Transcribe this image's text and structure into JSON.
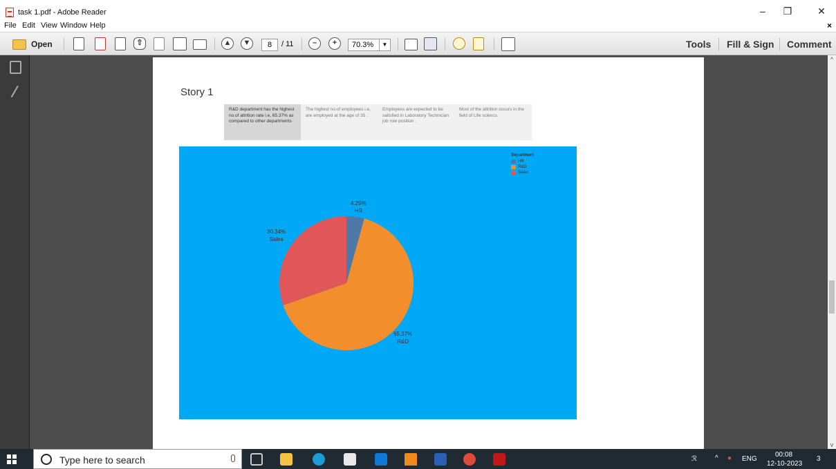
{
  "window": {
    "title": "task 1.pdf - Adobe Reader",
    "controls": {
      "minimize": "–",
      "restore": "❐",
      "close": "✕"
    }
  },
  "menu": {
    "items": [
      "File",
      "Edit",
      "View",
      "Window",
      "Help"
    ],
    "close": "×"
  },
  "toolbar": {
    "open_label": "Open",
    "page_current": "8",
    "page_total": "/ 11",
    "zoom": "70.3%",
    "right_tools": [
      "Tools",
      "Fill & Sign",
      "Comment"
    ]
  },
  "document": {
    "story_title": "Story 1",
    "captions": [
      "R&D department has the highest no.of attrition rate i.e, 65.37% as compared to other departments",
      "The highest no.of employees i.e, are employed at the age of 35 .",
      "Employees are expected to be satisfied in Laboratory Technician job role position .",
      "Most of the attrition occurs in the field of Life sciencs."
    ]
  },
  "chart_data": {
    "type": "pie",
    "background": "#00a8f5",
    "legend_title": "Department",
    "legend_position": "top-right",
    "slices": [
      {
        "name": "HR",
        "value": 4.29,
        "label": "4.29%",
        "color": "#4e79a7"
      },
      {
        "name": "R&D",
        "value": 65.37,
        "label": "65.37%",
        "color": "#f28e2b"
      },
      {
        "name": "Sales",
        "value": 30.34,
        "label": "30.34%",
        "color": "#e15759"
      }
    ]
  },
  "taskbar": {
    "search_placeholder": "Type here to search",
    "tray": {
      "lang": "ENG",
      "time": "00:08",
      "date": "12-10-2023",
      "notifications": "3"
    }
  },
  "colors": {
    "taskbar_bg": "#1f2a33",
    "doc_bg": "#4d4d4d",
    "nav_bg": "#3b3b3b"
  }
}
